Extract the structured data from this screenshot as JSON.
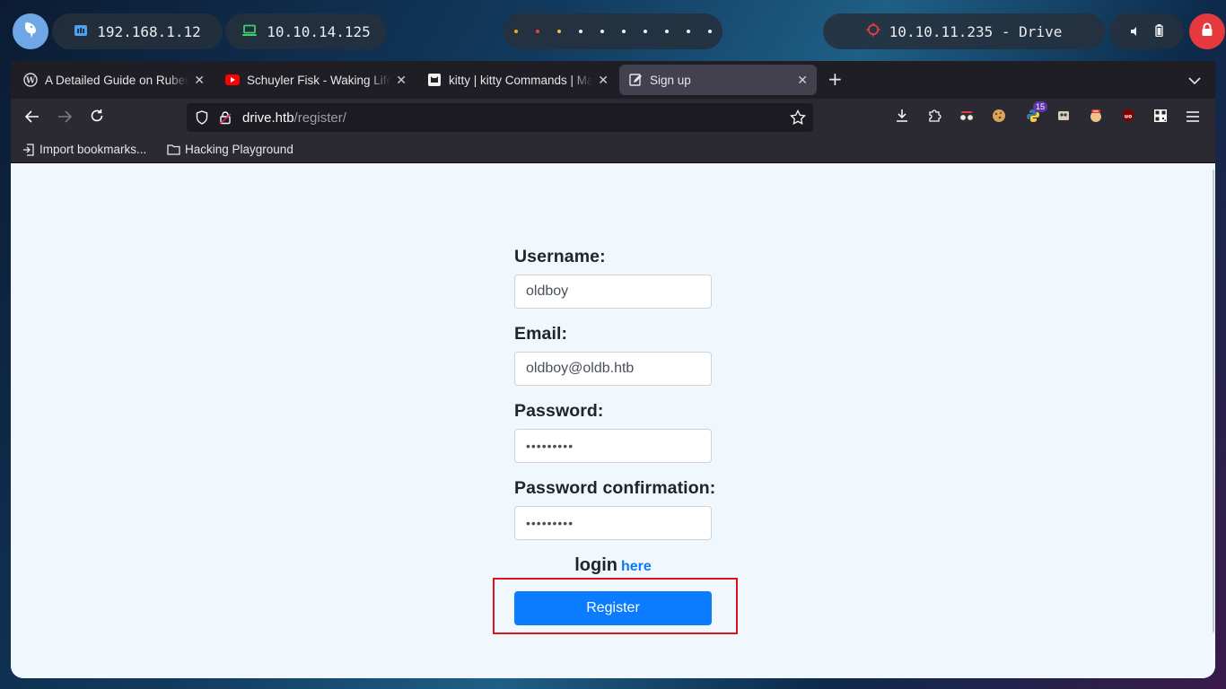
{
  "desktop": {
    "launcher_icon": "parrot-icon",
    "local_ip": "192.168.1.12",
    "vpn_ip": "10.10.14.125",
    "workspace_dots": [
      "#f5a623",
      "#e8453c",
      "#f5c043",
      "#f2f2f2",
      "#f2f2f2",
      "#f2f2f2",
      "#f2f2f2",
      "#f2f2f2",
      "#f2f2f2",
      "#f2f2f2"
    ],
    "target": "10.10.11.235 - Drive",
    "target_icon_color": "#e5393e",
    "lock_color": "#e5393e"
  },
  "browser": {
    "tabs": [
      {
        "title": "A Detailed Guide on Rubeus",
        "icon": "wordpress-icon"
      },
      {
        "title": "Schuyler Fisk - Waking Life",
        "icon": "youtube-icon"
      },
      {
        "title": "kitty | kitty Commands | Man",
        "icon": "kitty-icon"
      },
      {
        "title": "Sign up",
        "icon": "signup-icon",
        "active": true
      }
    ],
    "url_host": "drive.htb",
    "url_path": "/register/",
    "extension_badge": "15",
    "bookmarks": [
      {
        "label": "Import bookmarks...",
        "icon": "import-icon"
      },
      {
        "label": "Hacking Playground",
        "icon": "folder-icon"
      }
    ]
  },
  "form": {
    "username_label": "Username:",
    "username_value": "oldboy",
    "email_label": "Email:",
    "email_value": "oldboy@oldb.htb",
    "password_label": "Password:",
    "password_value": "•••••••••",
    "confirm_label": "Password confirmation:",
    "confirm_value": "•••••••••",
    "login_text": "login",
    "login_link": "here",
    "register_button": "Register",
    "accent_color": "#0b7bff",
    "highlight_color": "#e0121a"
  }
}
